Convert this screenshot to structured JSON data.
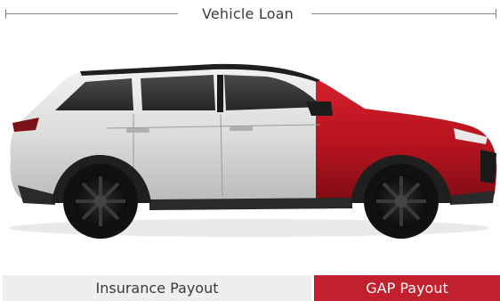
{
  "loan": {
    "label": "Vehicle Loan"
  },
  "illustration": {
    "subject": "crossover SUV, rear portion silver and front portion red",
    "colors": {
      "body_silver": "#d9d9d9",
      "body_red": "#b8141f",
      "tire": "#151515",
      "window": "#3a3a3a"
    }
  },
  "payouts": {
    "insurance_label": "Insurance Payout",
    "gap_label": "GAP Payout",
    "colors": {
      "insurance_bg": "#eeeeee",
      "gap_bg": "#c1202d"
    }
  }
}
